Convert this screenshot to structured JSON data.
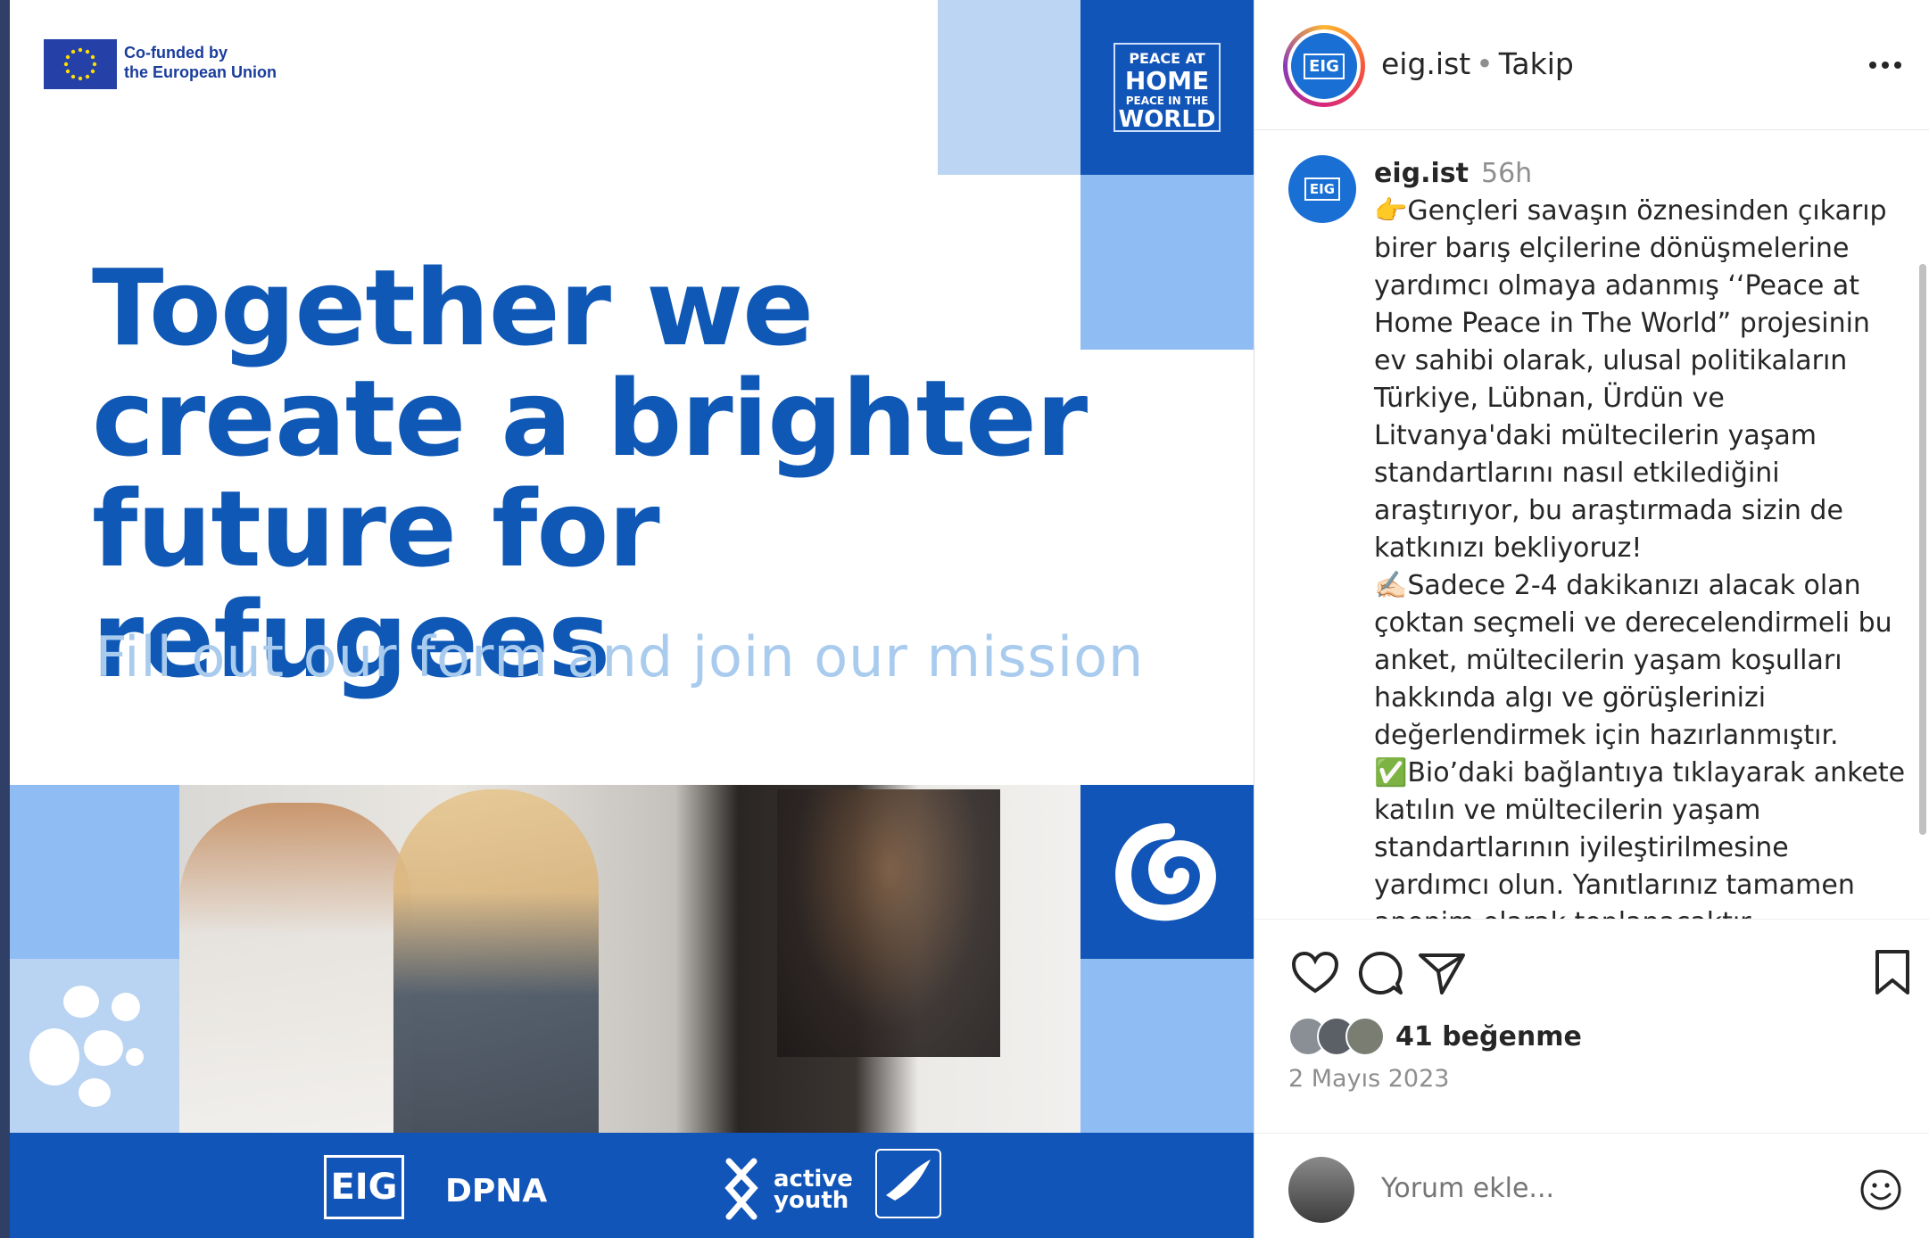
{
  "post_image": {
    "eu_line1": "Co-funded by",
    "eu_line2": "the European Union",
    "badge_lines": [
      "PEACE AT",
      "HOME",
      "PEACE IN THE",
      "WORLD"
    ],
    "headline_lines": [
      "Together we",
      "create a brighter",
      "future for refugees"
    ],
    "subline": "Fill out our form and join our mission",
    "partners": {
      "eig": "EIG",
      "dpna": "DPNA",
      "active_youth_1": "active",
      "active_youth_2": "youth"
    },
    "colors": {
      "primary_blue": "#1255b8",
      "light_blue": "#8fbcf2",
      "pale_blue": "#bcd5f2"
    }
  },
  "header": {
    "username": "eig.ist",
    "separator": "•",
    "follow_label": "Takip",
    "avatar_label": "EIG",
    "more_icon": "more-horizontal-icon"
  },
  "caption": {
    "username": "eig.ist",
    "time": "56h",
    "body": "👉Gençleri savaşın öznesinden çıkarıp birer barış elçilerine dönüşmelerine yardımcı olmaya adanmış ‘‘Peace at Home Peace in The World” projesinin ev sahibi olarak, ulusal politikaların Türkiye, Lübnan, Ürdün ve Litvanya'daki mültecilerin yaşam standartlarını nasıl etkilediğini araştırıyor, bu araştırmada sizin de katkınızı bekliyoruz!\n✍🏻Sadece 2-4 dakikanızı alacak olan çoktan seçmeli ve derecelendirmeli bu anket, mültecilerin yaşam koşulları hakkında algı ve görüşlerinizi değerlendirmek için hazırlanmıştır.\n✅Bio’daki bağlantıya tıklayarak ankete katılın ve mültecilerin yaşam standartlarının iyileştirilmesine yardımcı olun. Yanıtlarınız tamamen anonim olarak toplanacaktır. Zamanınızı"
  },
  "actions": {
    "like_icon": "heart-icon",
    "comment_icon": "comment-icon",
    "share_icon": "send-icon",
    "save_icon": "bookmark-icon"
  },
  "likes_text": "41 beğenme",
  "date": "2 Mayıs 2023",
  "comment": {
    "placeholder": "Yorum ekle...",
    "emoji_icon": "emoji-icon"
  }
}
